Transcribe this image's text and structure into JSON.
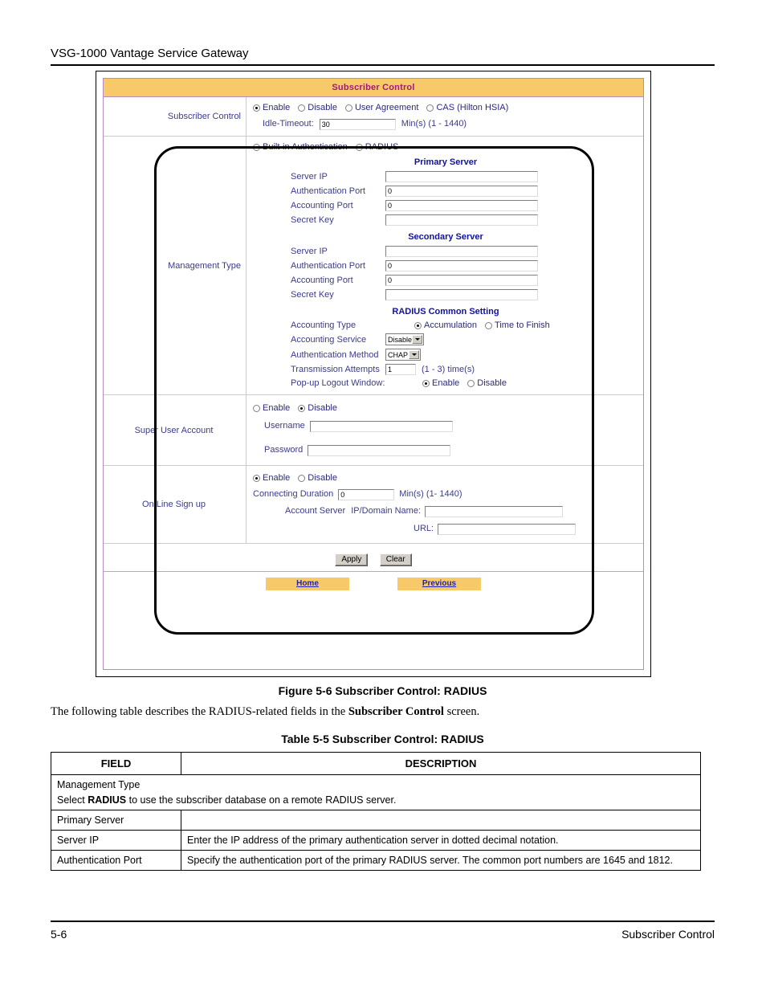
{
  "page": {
    "running_header": "VSG-1000 Vantage Service Gateway",
    "footer_left": "5-6",
    "footer_right": "Subscriber Control",
    "figure_caption": "Figure 5-6 Subscriber Control: RADIUS",
    "paragraph_before": "The following table describes the RADIUS-related fields in the ",
    "paragraph_bold": "Subscriber Control",
    "paragraph_after": " screen.",
    "table_caption": "Table 5-5 Subscriber Control: RADIUS"
  },
  "screenshot": {
    "title": "Subscriber Control",
    "colors": {
      "title_bar_bg": "#f8c969",
      "title_text": "#a01a7d",
      "frame_border": "#b98cc0",
      "label_text": "#3b3b8c",
      "section_heading": "#12129c",
      "link_text": "#2222aa"
    },
    "subscriber_control": {
      "label": "Subscriber Control",
      "modes": [
        {
          "label": "Enable",
          "selected": true
        },
        {
          "label": "Disable",
          "selected": false
        },
        {
          "label": "User Agreement",
          "selected": false
        },
        {
          "label": "CAS (Hilton HSIA)",
          "selected": false
        }
      ],
      "idle_timeout_label": "Idle-Timeout:",
      "idle_timeout_value": "30",
      "idle_timeout_hint": "Min(s) (1 - 1440)"
    },
    "management_type": {
      "label": "Management Type",
      "auth_modes": [
        {
          "label": "Built-in Authentication",
          "selected": false
        },
        {
          "label": "RADIUS",
          "selected": true
        }
      ],
      "primary_server": {
        "heading": "Primary Server",
        "fields": [
          {
            "label": "Server IP",
            "value": ""
          },
          {
            "label": "Authentication Port",
            "value": "0"
          },
          {
            "label": "Accounting Port",
            "value": "0"
          },
          {
            "label": "Secret Key",
            "value": ""
          }
        ]
      },
      "secondary_server": {
        "heading": "Secondary Server",
        "fields": [
          {
            "label": "Server IP",
            "value": ""
          },
          {
            "label": "Authentication Port",
            "value": "0"
          },
          {
            "label": "Accounting Port",
            "value": "0"
          },
          {
            "label": "Secret Key",
            "value": ""
          }
        ]
      },
      "common": {
        "heading": "RADIUS Common Setting",
        "accounting_type_label": "Accounting Type",
        "accounting_type_options": [
          {
            "label": "Accumulation",
            "selected": true
          },
          {
            "label": "Time to Finish",
            "selected": false
          }
        ],
        "accounting_service_label": "Accounting Service",
        "accounting_service_value": "Disable",
        "auth_method_label": "Authentication Method",
        "auth_method_value": "CHAP",
        "transmission_label": "Transmission Attempts",
        "transmission_value": "1",
        "transmission_hint": "(1 - 3) time(s)",
        "popup_label": "Pop-up Logout Window:",
        "popup_options": [
          {
            "label": "Enable",
            "selected": true
          },
          {
            "label": "Disable",
            "selected": false
          }
        ]
      }
    },
    "super_user": {
      "label": "Super User Account",
      "options": [
        {
          "label": "Enable",
          "selected": false
        },
        {
          "label": "Disable",
          "selected": true
        }
      ],
      "username_label": "Username",
      "username_value": "",
      "password_label": "Password",
      "password_value": ""
    },
    "online_signup": {
      "label": "On Line Sign up",
      "options": [
        {
          "label": "Enable",
          "selected": true
        },
        {
          "label": "Disable",
          "selected": false
        }
      ],
      "duration_label": "Connecting Duration",
      "duration_value": "0",
      "duration_hint": "Min(s) (1- 1440)",
      "account_server_label": "Account Server",
      "ip_domain_label": "IP/Domain Name:",
      "ip_domain_value": "",
      "url_label": "URL:",
      "url_value": ""
    },
    "buttons": {
      "apply": "Apply",
      "clear": "Clear",
      "home": "Home",
      "previous": "Previous"
    }
  },
  "table": {
    "headers": [
      "FIELD",
      "DESCRIPTION"
    ],
    "rows": [
      {
        "kind": "span",
        "line1": "Management Type",
        "line2_pre": "Select ",
        "line2_bold": "RADIUS",
        "line2_post": " to use the subscriber database on a remote RADIUS server."
      },
      {
        "kind": "section",
        "field": "Primary Server",
        "description": ""
      },
      {
        "kind": "field",
        "field": "Server IP",
        "description": "Enter the IP address of the primary authentication server in dotted decimal notation."
      },
      {
        "kind": "field",
        "field": "Authentication Port",
        "description": "Specify the authentication port of the primary RADIUS server. The common port numbers are 1645 and 1812."
      }
    ]
  }
}
